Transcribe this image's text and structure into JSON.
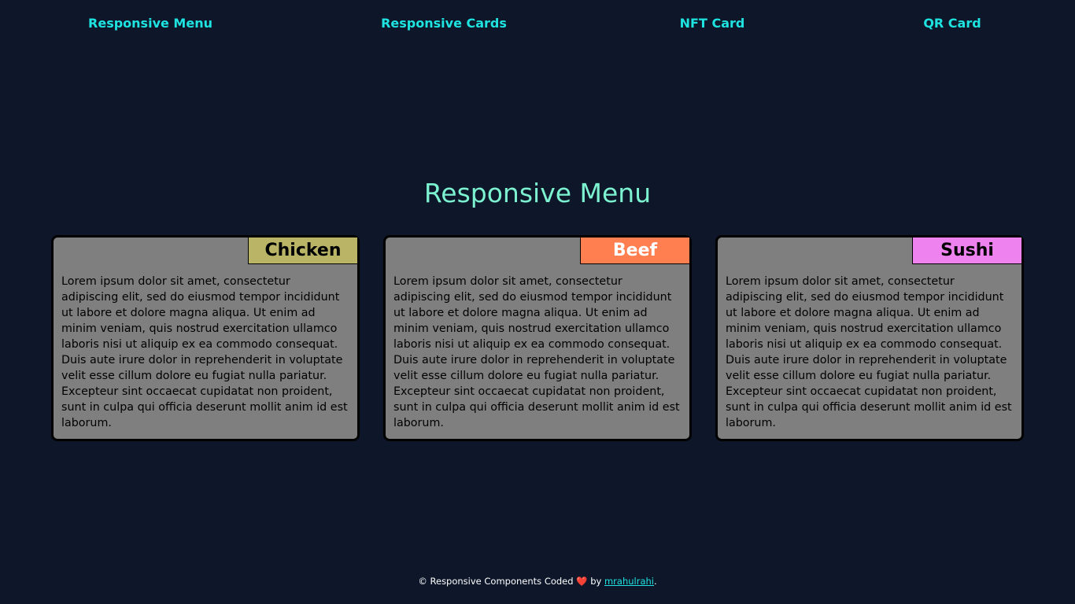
{
  "nav": {
    "items": [
      {
        "label": "Responsive Menu"
      },
      {
        "label": "Responsive Cards"
      },
      {
        "label": "NFT Card"
      },
      {
        "label": "QR Card"
      }
    ]
  },
  "main": {
    "title": "Responsive Menu",
    "cards": [
      {
        "label": "Chicken",
        "label_color": "#bab566",
        "label_text_color": "#000000",
        "body": "Lorem ipsum dolor sit amet, consectetur adipiscing elit, sed do eiusmod tempor incididunt ut labore et dolore magna aliqua. Ut enim ad minim veniam, quis nostrud exercitation ullamco laboris nisi ut aliquip ex ea commodo consequat. Duis aute irure dolor in reprehenderit in voluptate velit esse cillum dolore eu fugiat nulla pariatur. Excepteur sint occaecat cupidatat non proident, sunt in culpa qui officia deserunt mollit anim id est laborum."
      },
      {
        "label": "Beef",
        "label_color": "#ff7f50",
        "label_text_color": "#ffffff",
        "body": "Lorem ipsum dolor sit amet, consectetur adipiscing elit, sed do eiusmod tempor incididunt ut labore et dolore magna aliqua. Ut enim ad minim veniam, quis nostrud exercitation ullamco laboris nisi ut aliquip ex ea commodo consequat. Duis aute irure dolor in reprehenderit in voluptate velit esse cillum dolore eu fugiat nulla pariatur. Excepteur sint occaecat cupidatat non proident, sunt in culpa qui officia deserunt mollit anim id est laborum."
      },
      {
        "label": "Sushi",
        "label_color": "#ee82ee",
        "label_text_color": "#000000",
        "body": "Lorem ipsum dolor sit amet, consectetur adipiscing elit, sed do eiusmod tempor incididunt ut labore et dolore magna aliqua. Ut enim ad minim veniam, quis nostrud exercitation ullamco laboris nisi ut aliquip ex ea commodo consequat. Duis aute irure dolor in reprehenderit in voluptate velit esse cillum dolore eu fugiat nulla pariatur. Excepteur sint occaecat cupidatat non proident, sunt in culpa qui officia deserunt mollit anim id est laborum."
      }
    ]
  },
  "footer": {
    "prefix": "© Responsive Components Coded",
    "heart": "❤️",
    "by": "by",
    "author": "mrahulrahi",
    "suffix": "."
  },
  "colors": {
    "background": "#0d1729",
    "nav_link": "#1ee3e0",
    "title": "#7cf2d0",
    "card_bg": "#7f7f7f"
  }
}
